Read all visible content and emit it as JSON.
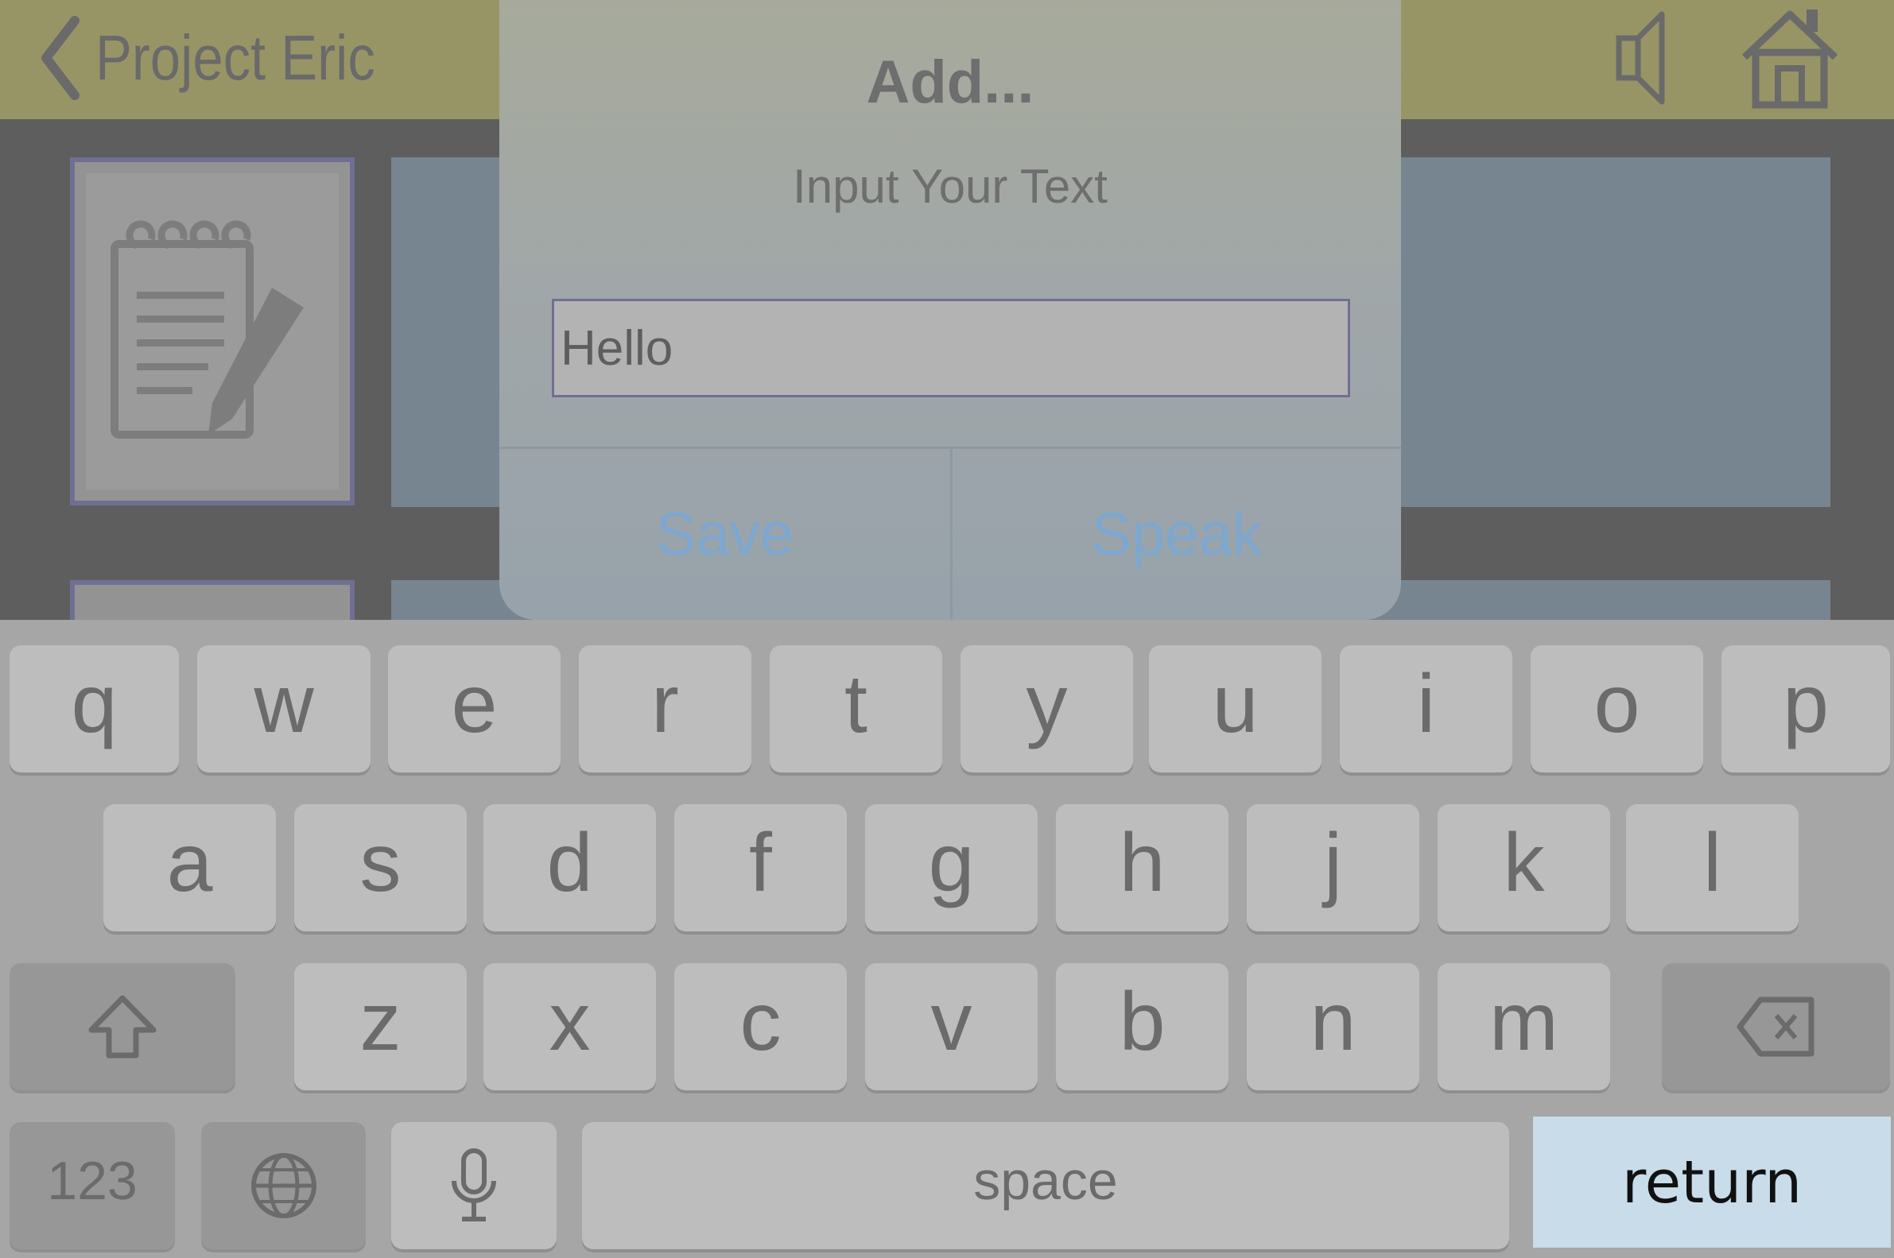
{
  "navbar": {
    "back_label": "Project Eric",
    "icons": [
      "chevron-left-icon",
      "speaker-icon",
      "home-icon"
    ]
  },
  "dialog": {
    "title": "Add...",
    "message": "Input Your Text",
    "input_value": "Hello",
    "save_label": "Save",
    "speak_label": "Speak"
  },
  "keyboard": {
    "row1": [
      "q",
      "w",
      "e",
      "r",
      "t",
      "y",
      "u",
      "i",
      "o",
      "p"
    ],
    "row2": [
      "a",
      "s",
      "d",
      "f",
      "g",
      "h",
      "j",
      "k",
      "l"
    ],
    "row3": [
      "z",
      "x",
      "c",
      "v",
      "b",
      "n",
      "m"
    ],
    "numbers_label": "123",
    "space_label": "space",
    "return_label": "return",
    "icons": [
      "shift-icon",
      "backspace-icon",
      "globe-icon",
      "microphone-icon"
    ]
  },
  "colors": {
    "navbar": "#979565",
    "dialog_button_text": "#7da7cf",
    "return_key": "#c8dcea"
  }
}
